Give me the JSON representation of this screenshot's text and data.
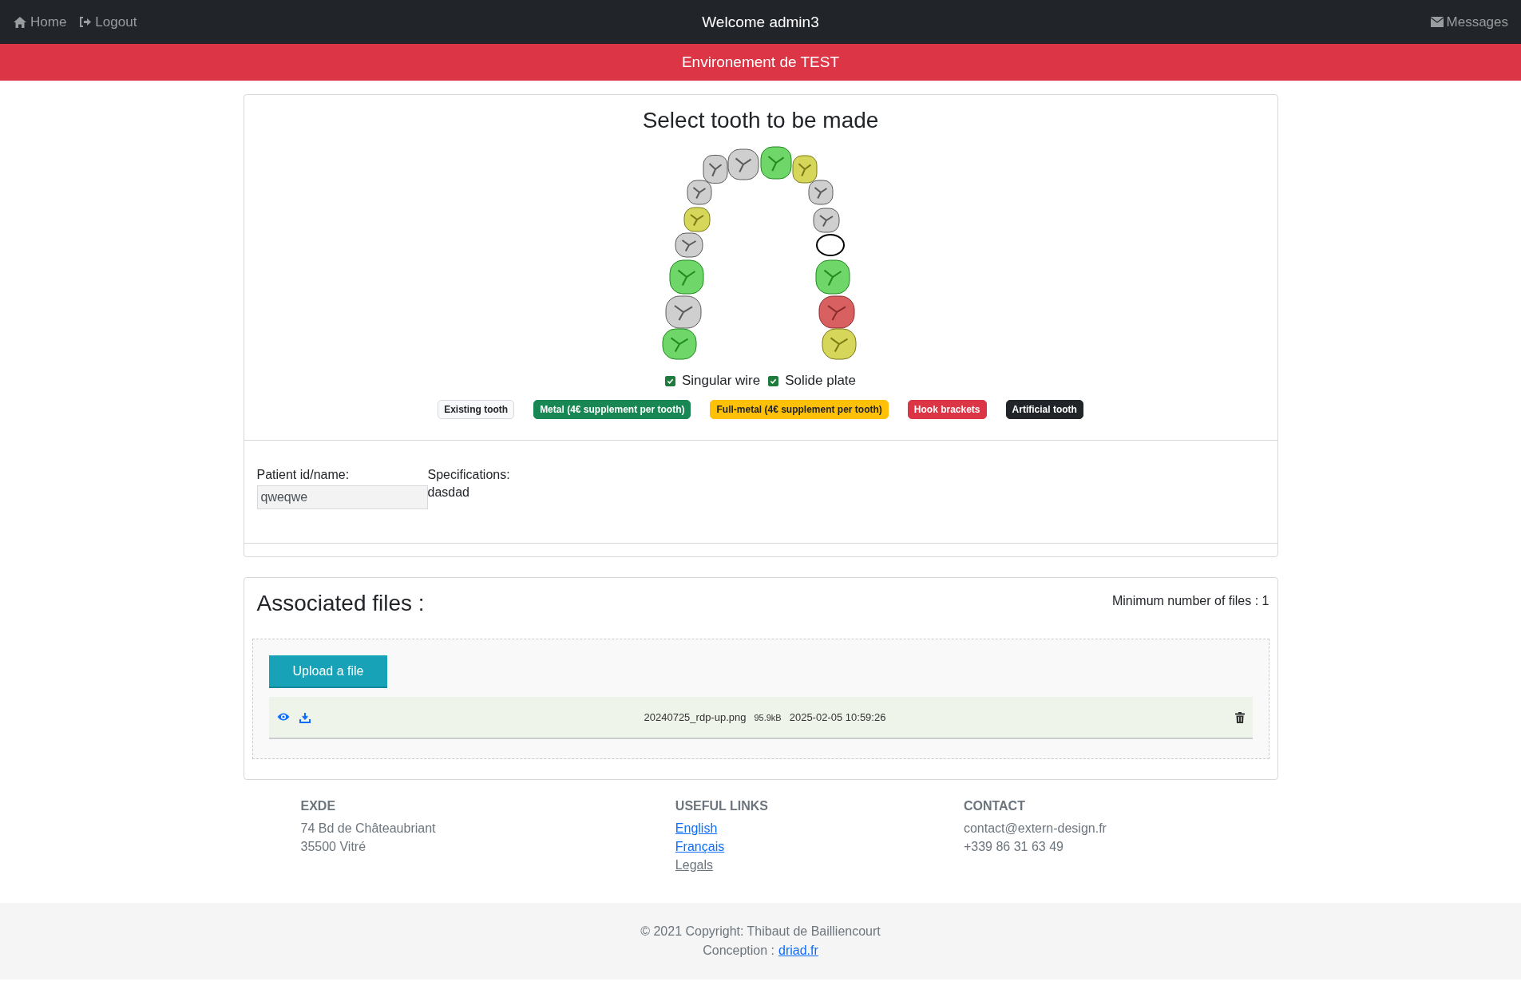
{
  "navbar": {
    "home": "Home",
    "logout": "Logout",
    "title": "Welcome admin3",
    "messages": "Messages"
  },
  "banner": "Environement de TEST",
  "tooth_card": {
    "title": "Select tooth to be made",
    "teeth": [
      {
        "kind": "existing"
      },
      {
        "kind": "existing"
      },
      {
        "kind": "metal"
      },
      {
        "kind": "full_metal"
      },
      {
        "kind": "existing"
      },
      {
        "kind": "existing"
      },
      {
        "kind": "full_metal"
      },
      {
        "kind": "existing"
      },
      {
        "kind": "existing"
      },
      {
        "kind": "empty"
      },
      {
        "kind": "metal"
      },
      {
        "kind": "metal"
      },
      {
        "kind": "existing"
      },
      {
        "kind": "hook"
      },
      {
        "kind": "metal"
      },
      {
        "kind": "full_metal"
      }
    ],
    "options": [
      {
        "label": "Singular wire",
        "checked": true
      },
      {
        "label": "Solide plate",
        "checked": true
      }
    ],
    "legend": [
      {
        "label": "Existing tooth",
        "kind": "existing"
      },
      {
        "label": "Metal (4€ supplement per tooth)",
        "kind": "metal"
      },
      {
        "label": "Full-metal (4€ supplement per tooth)",
        "kind": "full_metal"
      },
      {
        "label": "Hook brackets",
        "kind": "hook"
      },
      {
        "label": "Artificial tooth",
        "kind": "artificial"
      }
    ],
    "patient": {
      "label": "Patient id/name:",
      "value": "qweqwe"
    },
    "specifications": {
      "label": "Specifications:",
      "value": "dasdad"
    }
  },
  "files_card": {
    "title": "Associated files :",
    "minimum": "Minimum number of files : 1",
    "upload": "Upload a file",
    "files": [
      {
        "name": "20240725_rdp-up.png",
        "size": "95.9kB",
        "date": "2025-02-05 10:59:26"
      }
    ]
  },
  "footer": {
    "columns": [
      {
        "heading": "EXDE",
        "lines": [
          {
            "text": "74 Bd de Châteaubriant",
            "kind": "text"
          },
          {
            "text": "35500 Vitré",
            "kind": "text"
          }
        ]
      },
      {
        "heading": "USEFUL LINKS",
        "lines": [
          {
            "text": "English",
            "kind": "link"
          },
          {
            "text": "Français",
            "kind": "link"
          },
          {
            "text": "Legals",
            "kind": "muted_link"
          }
        ]
      },
      {
        "heading": "CONTACT",
        "lines": [
          {
            "text": "contact@extern-design.fr",
            "kind": "text"
          },
          {
            "text": "+339 86 31 63 49",
            "kind": "text"
          }
        ]
      }
    ],
    "copyright": "© 2021 Copyright: Thibaut de Bailliencourt",
    "conception": "Conception :",
    "conception_link": "driad.fr"
  }
}
